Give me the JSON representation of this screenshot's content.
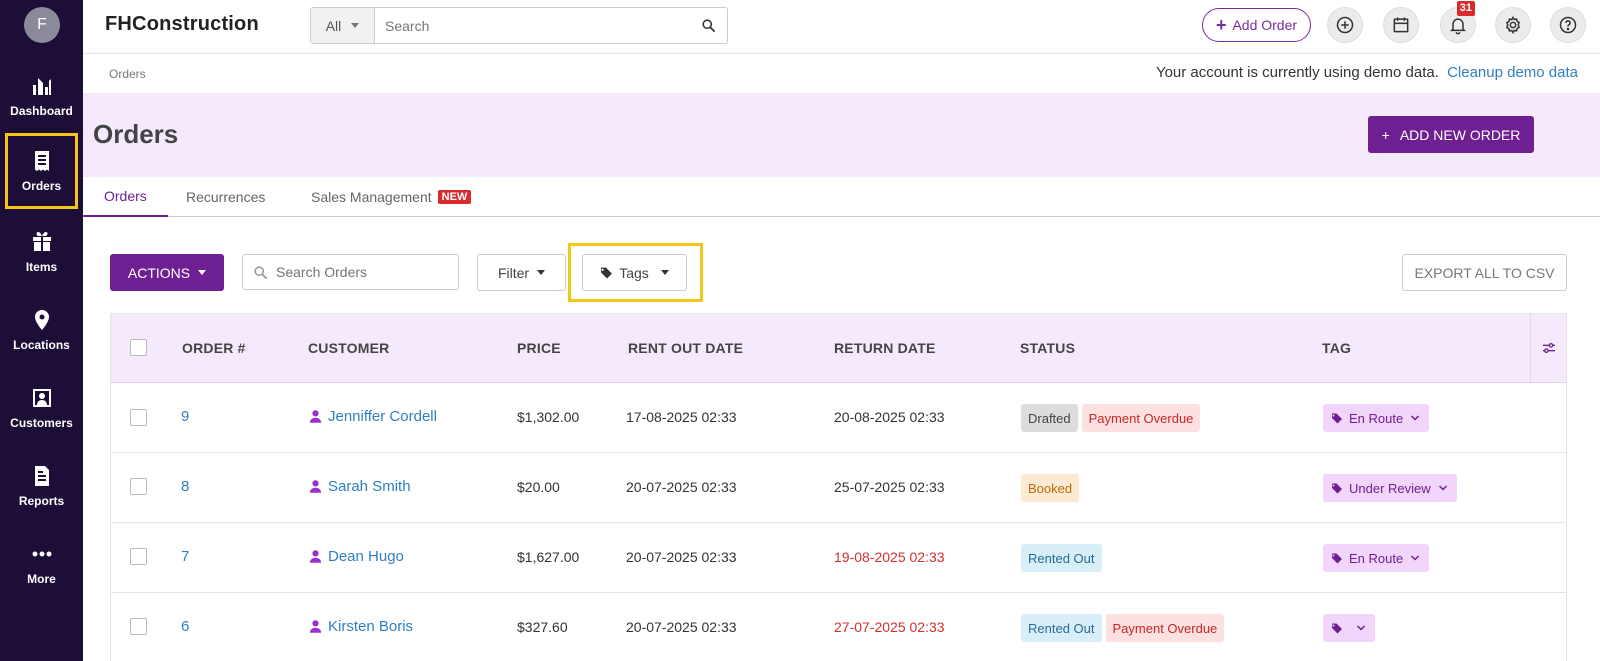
{
  "user": {
    "initial": "F"
  },
  "sidebar": {
    "items": [
      {
        "label": "Dashboard"
      },
      {
        "label": "Orders"
      },
      {
        "label": "Items"
      },
      {
        "label": "Locations"
      },
      {
        "label": "Customers"
      },
      {
        "label": "Reports"
      },
      {
        "label": "More"
      }
    ]
  },
  "topbar": {
    "brand": "FHConstruction",
    "search_scope": "All",
    "search_placeholder": "Search",
    "add_order_label": "Add Order",
    "notification_count": "31"
  },
  "breadcrumb": "Orders",
  "demo": {
    "note": "Your account is currently using demo data.",
    "link": "Cleanup demo data"
  },
  "header": {
    "title": "Orders",
    "add_new_label": "ADD NEW ORDER"
  },
  "tabs": [
    {
      "label": "Orders"
    },
    {
      "label": "Recurrences"
    },
    {
      "label": "Sales Management",
      "badge": "NEW"
    }
  ],
  "toolbar": {
    "actions_label": "ACTIONS",
    "search_placeholder": "Search Orders",
    "filter_label": "Filter",
    "tags_label": "Tags",
    "export_label": "EXPORT ALL TO CSV"
  },
  "table": {
    "columns": [
      "ORDER #",
      "CUSTOMER",
      "PRICE",
      "RENT OUT DATE",
      "RETURN DATE",
      "STATUS",
      "TAG"
    ],
    "rows": [
      {
        "order": "9",
        "customer": "Jenniffer Cordell",
        "price": "$1,302.00",
        "rent_out": "17-08-2025 02:33",
        "return": "20-08-2025 02:33",
        "return_overdue": false,
        "statuses": [
          "Drafted",
          "Payment Overdue"
        ],
        "tag": "En Route"
      },
      {
        "order": "8",
        "customer": "Sarah Smith",
        "price": "$20.00",
        "rent_out": "20-07-2025 02:33",
        "return": "25-07-2025 02:33",
        "return_overdue": false,
        "statuses": [
          "Booked"
        ],
        "tag": "Under Review"
      },
      {
        "order": "7",
        "customer": "Dean Hugo",
        "price": "$1,627.00",
        "rent_out": "20-07-2025 02:33",
        "return": "19-08-2025 02:33",
        "return_overdue": true,
        "statuses": [
          "Rented Out"
        ],
        "tag": "En Route"
      },
      {
        "order": "6",
        "customer": "Kirsten Boris",
        "price": "$327.60",
        "rent_out": "20-07-2025 02:33",
        "return": "27-07-2025 02:33",
        "return_overdue": true,
        "statuses": [
          "Rented Out",
          "Payment Overdue"
        ],
        "tag": ""
      }
    ]
  },
  "colors": {
    "sidebar_bg": "#1c0e36",
    "accent": "#6e1f92",
    "link": "#2f7fc1",
    "highlight": "#f5c518"
  }
}
